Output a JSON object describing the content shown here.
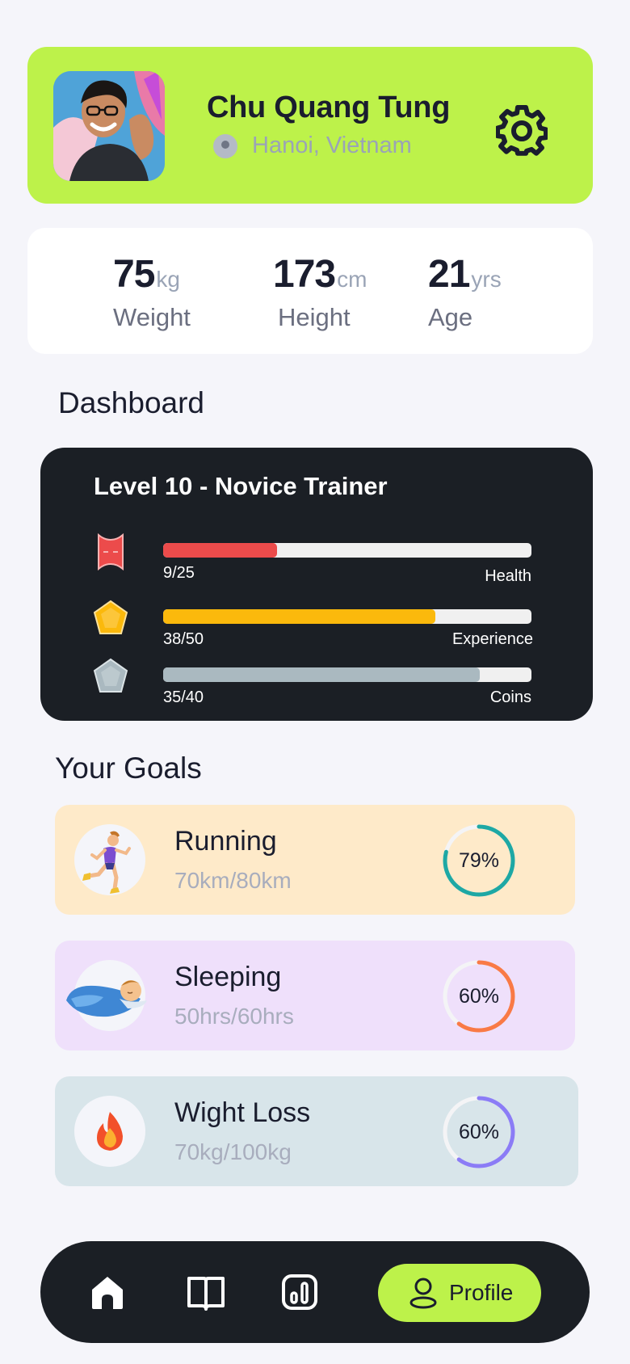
{
  "profile": {
    "name": "Chu Quang Tung",
    "location": "Hanoi, Vietnam",
    "location_icon": "location-pin-icon",
    "settings_icon": "gear-icon"
  },
  "stats": [
    {
      "value": "75",
      "unit": "kg",
      "label": "Weight"
    },
    {
      "value": "173",
      "unit": "cm",
      "label": "Height"
    },
    {
      "value": "21",
      "unit": "yrs",
      "label": "Age"
    }
  ],
  "dashboard": {
    "title": "Dashboard",
    "level_title": "Level 10 - Novice Trainer",
    "bars": [
      {
        "label": "Health",
        "count": "9/25",
        "fill": 0.31,
        "color": "#ec4b4b",
        "icon": "health-icon"
      },
      {
        "label": "Experience",
        "count": "38/50",
        "fill": 0.74,
        "color": "#fbb90c",
        "icon": "experience-gem-icon"
      },
      {
        "label": "Coins",
        "count": "35/40",
        "fill": 0.86,
        "color": "#aab9c0",
        "icon": "coin-gem-icon"
      }
    ]
  },
  "goals": {
    "title": "Your Goals",
    "items": [
      {
        "name": "Running",
        "progress": "70km/80km",
        "percent": "79%",
        "fraction": 0.79,
        "color": "#1ea8a4",
        "background": "#feeac9",
        "icon": "running-icon"
      },
      {
        "name": "Sleeping",
        "progress": "50hrs/60hrs",
        "percent": "60%",
        "fraction": 0.6,
        "color": "#f97a46",
        "background": "#efe0fb",
        "icon": "sleeping-icon"
      },
      {
        "name": "Wight Loss",
        "progress": "70kg/100kg",
        "percent": "60%",
        "fraction": 0.6,
        "color": "#8b7cf6",
        "background": "#d8e5ea",
        "icon": "fire-icon"
      }
    ]
  },
  "nav": {
    "items": [
      "home-icon",
      "book-icon",
      "stats-icon"
    ],
    "active_label": "Profile",
    "active_icon": "user-icon",
    "accent": "#bdf24a"
  }
}
